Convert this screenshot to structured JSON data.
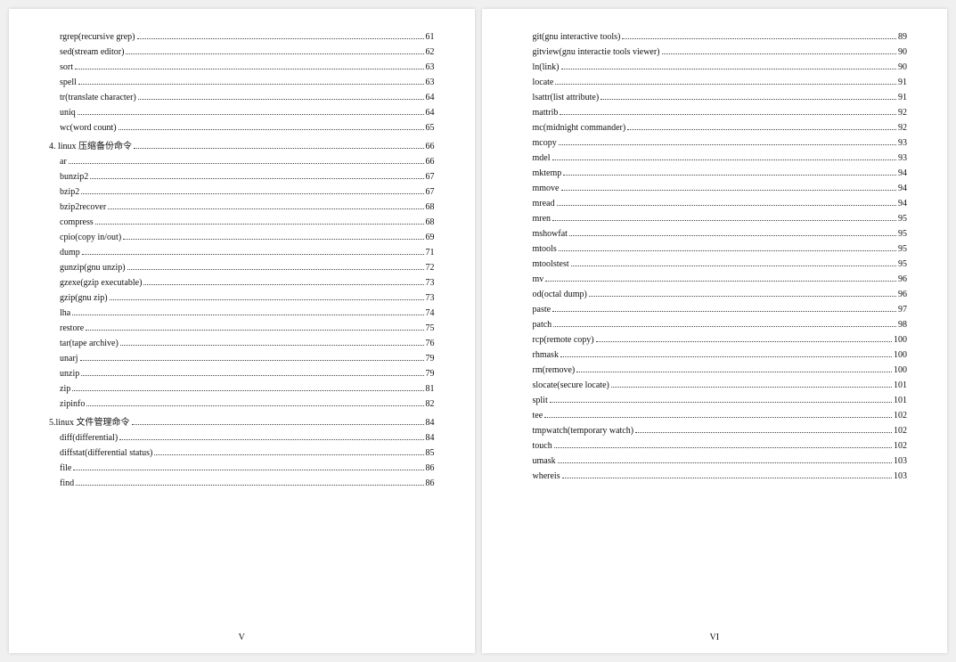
{
  "pages": [
    {
      "footer": "V",
      "entries": [
        {
          "indent": 2,
          "title": "rgrep(recursive grep)",
          "page": "61"
        },
        {
          "indent": 2,
          "title": "sed(stream editor)",
          "page": "62"
        },
        {
          "indent": 2,
          "title": "sort",
          "page": "63"
        },
        {
          "indent": 2,
          "title": "spell",
          "page": "63"
        },
        {
          "indent": 2,
          "title": "tr(translate character)",
          "page": "64"
        },
        {
          "indent": 2,
          "title": "uniq",
          "page": "64"
        },
        {
          "indent": 2,
          "title": "wc(word count)",
          "page": "65"
        },
        {
          "indent": 1,
          "title": "4. linux 压缩备份命令",
          "page": "66"
        },
        {
          "indent": 2,
          "title": "ar",
          "page": "66"
        },
        {
          "indent": 2,
          "title": "bunzip2",
          "page": "67"
        },
        {
          "indent": 2,
          "title": "bzip2",
          "page": "67"
        },
        {
          "indent": 2,
          "title": "bzip2recover",
          "page": "68"
        },
        {
          "indent": 2,
          "title": "compress",
          "page": "68"
        },
        {
          "indent": 2,
          "title": "cpio(copy in/out)",
          "page": "69"
        },
        {
          "indent": 2,
          "title": "dump",
          "page": "71"
        },
        {
          "indent": 2,
          "title": "gunzip(gnu unzip)",
          "page": "72"
        },
        {
          "indent": 2,
          "title": "gzexe(gzip executable)",
          "page": "73"
        },
        {
          "indent": 2,
          "title": "gzip(gnu zip)",
          "page": "73"
        },
        {
          "indent": 2,
          "title": "lha",
          "page": "74"
        },
        {
          "indent": 2,
          "title": "restore",
          "page": "75"
        },
        {
          "indent": 2,
          "title": "tar(tape archive)",
          "page": "76"
        },
        {
          "indent": 2,
          "title": "unarj",
          "page": "79"
        },
        {
          "indent": 2,
          "title": "unzip",
          "page": "79"
        },
        {
          "indent": 2,
          "title": "zip",
          "page": "81"
        },
        {
          "indent": 2,
          "title": "zipinfo",
          "page": "82"
        },
        {
          "indent": 1,
          "title": "5.linux 文件管理命令",
          "page": "84"
        },
        {
          "indent": 2,
          "title": "diff(differential)",
          "page": "84"
        },
        {
          "indent": 2,
          "title": "diffstat(differential status)",
          "page": "85"
        },
        {
          "indent": 2,
          "title": "file",
          "page": "86"
        },
        {
          "indent": 2,
          "title": "find",
          "page": "86"
        }
      ]
    },
    {
      "footer": "VI",
      "entries": [
        {
          "indent": 2,
          "title": "git(gnu interactive tools)",
          "page": "89"
        },
        {
          "indent": 2,
          "title": "gitview(gnu interactie tools viewer)",
          "page": "90"
        },
        {
          "indent": 2,
          "title": "ln(link)",
          "page": "90"
        },
        {
          "indent": 2,
          "title": "locate",
          "page": "91"
        },
        {
          "indent": 2,
          "title": "lsattr(list attribute)",
          "page": "91"
        },
        {
          "indent": 2,
          "title": "mattrib",
          "page": "92"
        },
        {
          "indent": 2,
          "title": "mc(midnight commander)",
          "page": "92"
        },
        {
          "indent": 2,
          "title": "mcopy",
          "page": "93"
        },
        {
          "indent": 2,
          "title": "mdel",
          "page": "93"
        },
        {
          "indent": 2,
          "title": "mktemp",
          "page": "94"
        },
        {
          "indent": 2,
          "title": "mmove",
          "page": "94"
        },
        {
          "indent": 2,
          "title": "mread",
          "page": "94"
        },
        {
          "indent": 2,
          "title": "mren",
          "page": "95"
        },
        {
          "indent": 2,
          "title": "mshowfat",
          "page": "95"
        },
        {
          "indent": 2,
          "title": "mtools",
          "page": "95"
        },
        {
          "indent": 2,
          "title": "mtoolstest",
          "page": "95"
        },
        {
          "indent": 2,
          "title": "mv",
          "page": "96"
        },
        {
          "indent": 2,
          "title": "od(octal dump)",
          "page": "96"
        },
        {
          "indent": 2,
          "title": "paste",
          "page": "97"
        },
        {
          "indent": 2,
          "title": "patch",
          "page": "98"
        },
        {
          "indent": 2,
          "title": "rcp(remote copy)",
          "page": "100"
        },
        {
          "indent": 2,
          "title": "rhmask",
          "page": "100"
        },
        {
          "indent": 2,
          "title": "rm(remove)",
          "page": "100"
        },
        {
          "indent": 2,
          "title": "slocate(secure locate)",
          "page": "101"
        },
        {
          "indent": 2,
          "title": "split",
          "page": "101"
        },
        {
          "indent": 2,
          "title": "tee",
          "page": "102"
        },
        {
          "indent": 2,
          "title": "tmpwatch(temporary watch)",
          "page": "102"
        },
        {
          "indent": 2,
          "title": "touch",
          "page": "102"
        },
        {
          "indent": 2,
          "title": "umask",
          "page": "103"
        },
        {
          "indent": 2,
          "title": "whereis",
          "page": "103"
        }
      ]
    }
  ]
}
